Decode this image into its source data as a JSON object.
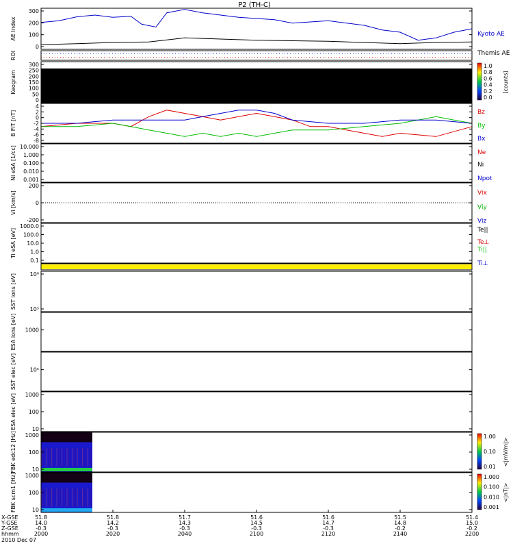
{
  "title": "P2 (TH-C)",
  "date_label": "2010 Dec 07",
  "time_labels": [
    "2000",
    "2020",
    "2040",
    "2100",
    "2120",
    "2140",
    "2200"
  ],
  "coord_rows": {
    "labels": [
      "X-GSE",
      "Y-GSE",
      "Z-GSE",
      "hhmm"
    ],
    "x": [
      "51.8",
      "51.8",
      "51.7",
      "51.6",
      "51.6",
      "51.5",
      "51.4"
    ],
    "y": [
      "14.0",
      "14.2",
      "14.3",
      "14.5",
      "14.7",
      "14.8",
      "15.0"
    ],
    "z": [
      "-0.3",
      "-0.3",
      "-0.3",
      "-0.3",
      "-0.3",
      "-0.2",
      "-0.2"
    ]
  },
  "colors": {
    "red": "#dd0000",
    "green": "#00bb00",
    "blue": "#0000cc",
    "yellow": "#ffee00",
    "black": "#000000"
  },
  "chart_data": [
    {
      "type": "line",
      "ylabel": "AE Index",
      "yticks": [
        "300",
        "200",
        "100",
        "0"
      ],
      "ylim": [
        -20,
        340
      ],
      "series": [
        {
          "name": "Kyoto AE",
          "color": "#0000cc",
          "x": [
            0,
            5,
            10,
            15,
            20,
            25,
            28,
            32,
            35,
            40,
            45,
            50,
            55,
            60,
            65,
            70,
            75,
            80,
            85,
            90,
            95,
            100,
            105,
            110,
            115,
            120
          ],
          "y": [
            215,
            230,
            265,
            280,
            260,
            270,
            200,
            175,
            300,
            330,
            300,
            280,
            260,
            250,
            240,
            210,
            220,
            230,
            210,
            190,
            150,
            130,
            60,
            80,
            130,
            160
          ]
        },
        {
          "name": "Themis AE",
          "color": "#000000",
          "x": [
            0,
            10,
            20,
            30,
            40,
            50,
            60,
            70,
            80,
            90,
            100,
            110,
            120
          ],
          "y": [
            20,
            30,
            40,
            45,
            80,
            70,
            60,
            55,
            50,
            40,
            30,
            40,
            45
          ]
        }
      ]
    },
    {
      "type": "line",
      "ylabel": "ROI",
      "yticks": [],
      "ylim": [
        0,
        1
      ],
      "series": []
    },
    {
      "type": "heatmap",
      "ylabel": "Keogram",
      "yticks": [
        "300",
        "250",
        "200",
        "150",
        "100",
        "50",
        "0"
      ],
      "colorbar_label": "[counts]",
      "colorbar_ticks": [
        "1.0",
        "0.8",
        "0.6",
        "0.4",
        "0.2",
        "0.0"
      ],
      "values": "all 0.0 (black)"
    },
    {
      "type": "line",
      "ylabel": "B FIT [nT]",
      "yticks": [
        "4",
        "2",
        "0",
        "-2",
        "-4",
        "-6",
        "-8"
      ],
      "ylim": [
        -8,
        4
      ],
      "series": [
        {
          "name": "Bz",
          "color": "#dd0000",
          "x": [
            0,
            10,
            20,
            25,
            30,
            35,
            40,
            45,
            50,
            55,
            60,
            65,
            70,
            75,
            80,
            85,
            90,
            95,
            100,
            110,
            120
          ],
          "y": [
            -3,
            -2,
            -2,
            -3,
            0,
            2,
            1,
            0,
            -1,
            0,
            1,
            0,
            -1,
            -3,
            -3,
            -4,
            -5,
            -6,
            -5,
            -6,
            -3
          ]
        },
        {
          "name": "By",
          "color": "#00bb00",
          "x": [
            0,
            10,
            20,
            25,
            30,
            35,
            40,
            45,
            50,
            55,
            60,
            65,
            70,
            80,
            90,
            100,
            110,
            115,
            120
          ],
          "y": [
            -3,
            -3,
            -2,
            -3,
            -4,
            -5,
            -6,
            -5,
            -6,
            -5,
            -6,
            -5,
            -4,
            -4,
            -3,
            -2,
            0,
            -1,
            -2
          ]
        },
        {
          "name": "Bx",
          "color": "#0000cc",
          "x": [
            0,
            10,
            20,
            25,
            30,
            35,
            40,
            45,
            50,
            55,
            60,
            65,
            70,
            80,
            90,
            100,
            110,
            120
          ],
          "y": [
            -2,
            -2,
            -1,
            -1,
            -1,
            -1,
            -1,
            0,
            1,
            2,
            2,
            1,
            -1,
            -2,
            -2,
            -1,
            -1,
            -2
          ]
        }
      ]
    },
    {
      "type": "line",
      "ylabel": "Ni eSA [1/cc]",
      "yticks": [
        "10.000",
        "1.000",
        "0.100",
        "0.010",
        "0.001"
      ],
      "series": [
        {
          "name": "Ne",
          "color": "#dd0000",
          "values": []
        },
        {
          "name": "Ni",
          "color": "#000000",
          "values": []
        },
        {
          "name": "Npot",
          "color": "#0000cc",
          "values": []
        }
      ]
    },
    {
      "type": "line",
      "ylabel": "Vi [km/s]",
      "yticks": [
        "200",
        "0",
        "-200"
      ],
      "ylim": [
        -300,
        300
      ],
      "series": [
        {
          "name": "Vix",
          "color": "#dd0000",
          "values": []
        },
        {
          "name": "Viy",
          "color": "#00bb00",
          "values": []
        },
        {
          "name": "Viz",
          "color": "#0000cc",
          "values": []
        }
      ]
    },
    {
      "type": "line",
      "ylabel": "Ti eSA [eV]",
      "yticks": [
        "1000.0",
        "100.0",
        "10.0",
        "1.0",
        "0.1"
      ],
      "series": [
        {
          "name": "Te||",
          "color": "#000000",
          "values": []
        },
        {
          "name": "Te⊥",
          "color": "#dd0000",
          "values": []
        },
        {
          "name": "Ti||",
          "color": "#00bb00",
          "values": []
        },
        {
          "name": "Ti⊥",
          "color": "#0000cc",
          "values": []
        }
      ]
    },
    {
      "type": "heatmap",
      "ylabel": "",
      "yticks": [],
      "values": "flag bar (yellow)"
    },
    {
      "type": "heatmap",
      "ylabel": "SST ions [eV]",
      "yticks": [
        "10⁶",
        "10⁵"
      ],
      "values": "no data"
    },
    {
      "type": "heatmap",
      "ylabel": "ESA ions [eV]",
      "yticks": [
        "1000"
      ],
      "values": "no data"
    },
    {
      "type": "heatmap",
      "ylabel": "SST elec [eV]",
      "yticks": [
        "10⁵"
      ],
      "values": "no data"
    },
    {
      "type": "heatmap",
      "ylabel": "ESA elec [eV]",
      "yticks": [
        "1000",
        "100",
        "10"
      ],
      "values": "no data"
    },
    {
      "type": "heatmap",
      "ylabel": "FBK edc12 [Hz]",
      "yticks": [
        "1000",
        "100",
        "10"
      ],
      "colorbar_label": "<|mV/m|>",
      "colorbar_ticks": [
        "1.00",
        "0.10",
        "0.01"
      ],
      "values": "data 2000-2015 only"
    },
    {
      "type": "heatmap",
      "ylabel": "FBK scm1 [Hz]",
      "yticks": [
        "1000",
        "100",
        "10"
      ],
      "colorbar_label": "<|nT|>",
      "colorbar_ticks": [
        "1.000",
        "0.100",
        "0.010",
        "0.001"
      ],
      "values": "data 2000-2015 only"
    }
  ]
}
